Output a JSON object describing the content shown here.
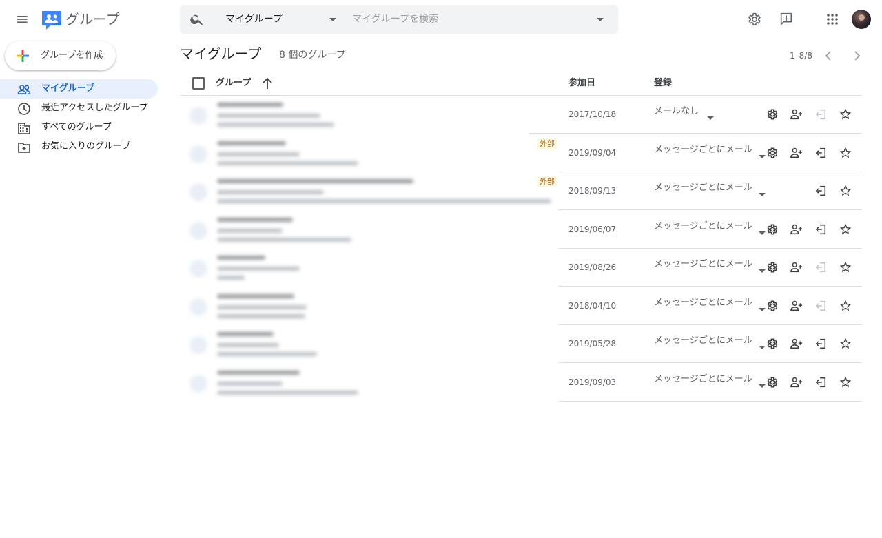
{
  "header": {
    "app_title": "グループ",
    "scope": "マイグループ",
    "search_placeholder": "マイグループを検索"
  },
  "sidebar": {
    "create_label": "グループを作成",
    "items": [
      {
        "label": "マイグループ",
        "icon": "people-icon",
        "active": true
      },
      {
        "label": "最近アクセスしたグループ",
        "icon": "clock-icon",
        "active": false
      },
      {
        "label": "すべてのグループ",
        "icon": "building-icon",
        "active": false
      },
      {
        "label": "お気に入りのグループ",
        "icon": "star-folder-icon",
        "active": false
      }
    ]
  },
  "main": {
    "title": "マイグループ",
    "count": "8 個のグループ",
    "pager": "1–8/8",
    "columns": {
      "group": "グループ",
      "joined": "参加日",
      "subscription": "登録"
    },
    "rows": [
      {
        "date": "2017/10/18",
        "subscription": "メールなし",
        "external": "",
        "settings": true,
        "add_member": true,
        "leave_enabled": false
      },
      {
        "date": "2019/09/04",
        "subscription": "メッセージごとにメール",
        "external": "外部",
        "settings": true,
        "add_member": true,
        "leave_enabled": true
      },
      {
        "date": "2018/09/13",
        "subscription": "メッセージごとにメール",
        "external": "外部",
        "settings": false,
        "add_member": false,
        "leave_enabled": true
      },
      {
        "date": "2019/06/07",
        "subscription": "メッセージごとにメール",
        "external": "",
        "settings": true,
        "add_member": true,
        "leave_enabled": true
      },
      {
        "date": "2019/08/26",
        "subscription": "メッセージごとにメール",
        "external": "",
        "settings": true,
        "add_member": true,
        "leave_enabled": false
      },
      {
        "date": "2018/04/10",
        "subscription": "メッセージごとにメール",
        "external": "",
        "settings": true,
        "add_member": true,
        "leave_enabled": false
      },
      {
        "date": "2019/05/28",
        "subscription": "メッセージごとにメール",
        "external": "",
        "settings": true,
        "add_member": true,
        "leave_enabled": true
      },
      {
        "date": "2019/09/03",
        "subscription": "メッセージごとにメール",
        "external": "",
        "settings": true,
        "add_member": true,
        "leave_enabled": true
      }
    ]
  },
  "colors": {
    "accent": "#1967d2",
    "active_bg": "#e8f0fe",
    "icon": "#5f6368"
  }
}
